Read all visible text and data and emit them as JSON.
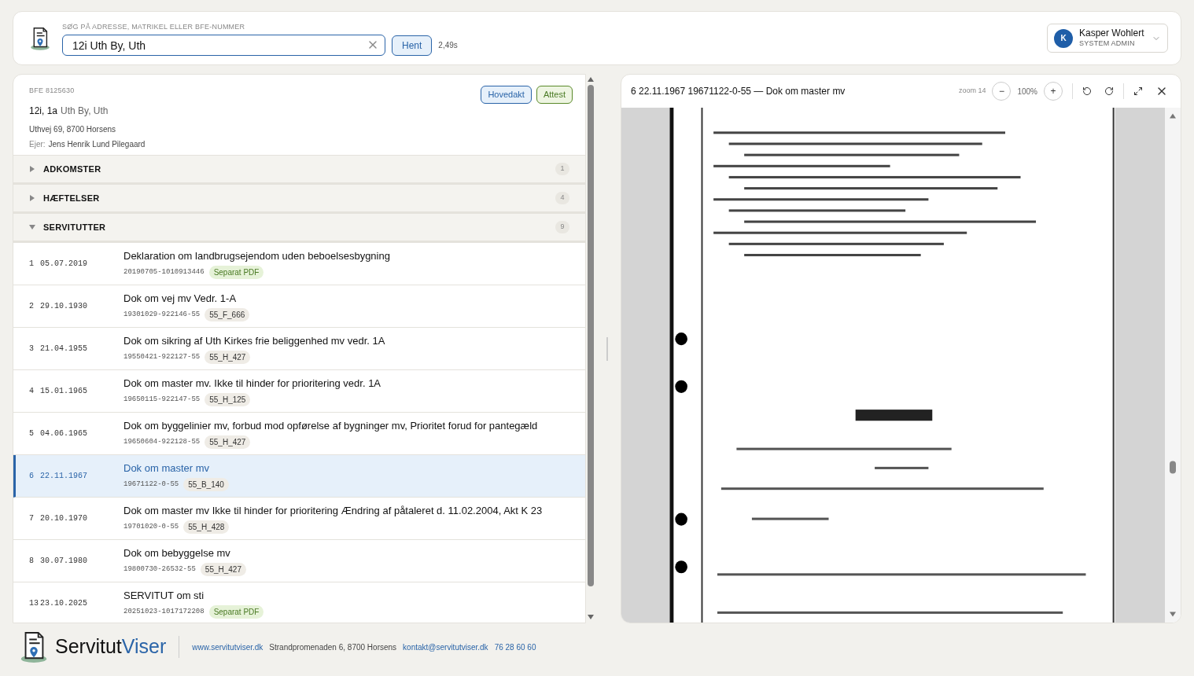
{
  "search": {
    "label": "SØG PÅ ADRESSE, MATRIKEL ELLER BFE-NUMMER",
    "value": "12i Uth By, Uth",
    "button": "Hent",
    "timing": "2,49s"
  },
  "user": {
    "initial": "K",
    "name": "Kasper Wohlert",
    "role": "SYSTEM ADMIN"
  },
  "property": {
    "bfe": "BFE 8125630",
    "matrikler": "12i, 1a",
    "ejerlav": "Uth By, Uth",
    "address": "Uthvej 69, 8700 Horsens",
    "owner_label": "Ejer:",
    "owner": "Jens Henrik Lund Pilegaard",
    "actions": [
      "Hovedakt",
      "Attest"
    ]
  },
  "sections": [
    {
      "title": "ADKOMSTER",
      "count": "1",
      "expanded": false
    },
    {
      "title": "HÆFTELSER",
      "count": "4",
      "expanded": false
    },
    {
      "title": "SERVITUTTER",
      "count": "9",
      "expanded": true,
      "rows": [
        {
          "num": "1",
          "date": "05.07.2019",
          "title": "Deklaration om landbrugsejendom uden beboelsesbygning",
          "doc": "20190705-1010913446",
          "tag": "Separat PDF",
          "kind": "pdf",
          "selected": false
        },
        {
          "num": "2",
          "date": "29.10.1930",
          "title": "Dok om vej mv Vedr. 1-A",
          "doc": "19301029-922146-55",
          "tag": "55_F_666",
          "kind": "code",
          "selected": false
        },
        {
          "num": "3",
          "date": "21.04.1955",
          "title": "Dok om sikring af Uth Kirkes frie beliggenhed mv vedr. 1A",
          "doc": "19550421-922127-55",
          "tag": "55_H_427",
          "kind": "code",
          "selected": false
        },
        {
          "num": "4",
          "date": "15.01.1965",
          "title": "Dok om master mv. Ikke til hinder for prioritering vedr. 1A",
          "doc": "19650115-922147-55",
          "tag": "55_H_125",
          "kind": "code",
          "selected": false
        },
        {
          "num": "5",
          "date": "04.06.1965",
          "title": "Dok om byggelinier mv, forbud mod opførelse af bygninger mv, Prioritet forud for pantegæld",
          "doc": "19650604-922128-55",
          "tag": "55_H_427",
          "kind": "code",
          "selected": false
        },
        {
          "num": "6",
          "date": "22.11.1967",
          "title": "Dok om master mv",
          "doc": "19671122-0-55",
          "tag": "55_B_140",
          "kind": "code",
          "selected": true
        },
        {
          "num": "7",
          "date": "20.10.1970",
          "title": "Dok om master mv Ikke til hinder for prioritering Ændring af påtaleret d. 11.02.2004, Akt K 23",
          "doc": "19701020-0-55",
          "tag": "55_H_428",
          "kind": "code",
          "selected": false
        },
        {
          "num": "8",
          "date": "30.07.1980",
          "title": "Dok om bebyggelse mv",
          "doc": "19800730-26532-55",
          "tag": "55_H_427",
          "kind": "code",
          "selected": false
        },
        {
          "num": "13",
          "date": "23.10.2025",
          "title": "SERVITUT om sti",
          "doc": "20251023-1017172208",
          "tag": "Separat PDF",
          "kind": "pdf",
          "selected": false
        }
      ]
    }
  ],
  "viewer": {
    "title": "6 22.11.1967 19671122-0-55 — Dok om master mv",
    "zoom_label": "zoom 14",
    "zoom_out": "−",
    "zoom_value": "100%",
    "zoom_in": "+"
  },
  "footer": {
    "brand_a": "Servitut",
    "brand_b": "Viser",
    "website": "www.servitutviser.dk",
    "address": "Strandpromenaden 6, 8700 Horsens",
    "email": "kontakt@servitutviser.dk",
    "phone": "76 28 60 60"
  }
}
